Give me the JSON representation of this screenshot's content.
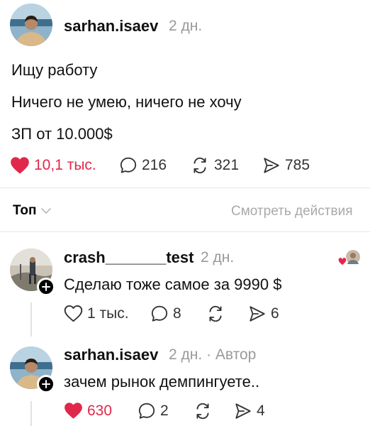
{
  "post": {
    "username": "sarhan.isaev",
    "time": "2 дн.",
    "lines": [
      "Ищу работу",
      "Ничего не умею, ничего не хочу",
      "ЗП от 10.000$"
    ],
    "likes": "10,1 тыс.",
    "comments": "216",
    "reposts": "321",
    "shares": "785"
  },
  "sort": {
    "label": "Топ",
    "view_activity": "Смотреть действия"
  },
  "replies": [
    {
      "username": "crash_______test",
      "time": "2 дн.",
      "text": "Сделаю тоже самое за 9990 $",
      "likes": "1 тыс.",
      "comments": "8",
      "reposts": "",
      "shares": "6",
      "liked": false
    },
    {
      "username": "sarhan.isaev",
      "time": "2 дн.",
      "author_tag": "· Автор",
      "text": "зачем рынок демпингуете..",
      "likes": "630",
      "comments": "2",
      "reposts": "",
      "shares": "4",
      "liked": true
    }
  ],
  "colors": {
    "like_red": "#e0284a",
    "muted": "#9a9a9a"
  }
}
